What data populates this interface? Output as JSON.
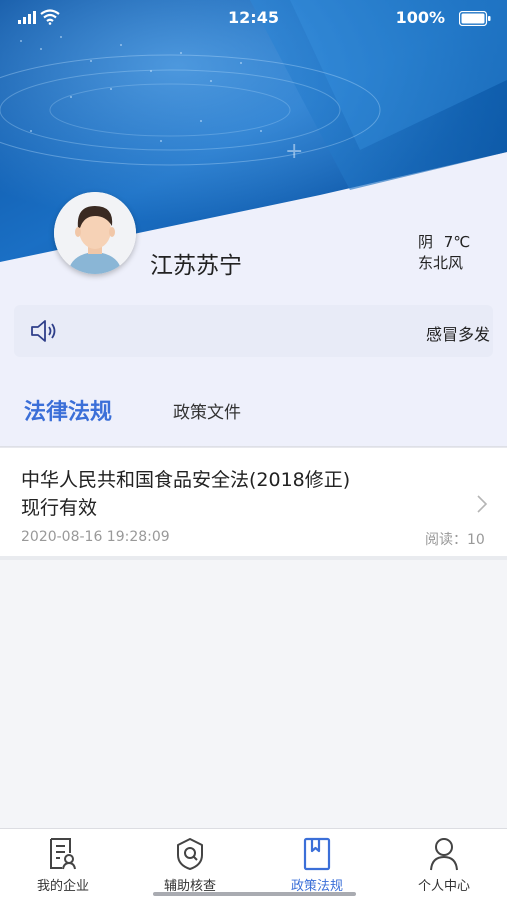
{
  "status_bar": {
    "time": "12:45",
    "battery": "100%",
    "icons": [
      "signal-icon",
      "wifi-icon",
      "battery-icon"
    ]
  },
  "profile": {
    "location": "江苏苏宁",
    "weather_condition": "阴",
    "temperature": "7℃",
    "wind": "东北风"
  },
  "notice": {
    "icon": "speaker-icon",
    "text": "感冒多发"
  },
  "tabs": [
    {
      "label": "法律法规",
      "active": true
    },
    {
      "label": "政策文件",
      "active": false
    }
  ],
  "list": [
    {
      "title": "中华人民共和国食品安全法(2018修正)现行有效",
      "date": "2020-08-16 19:28:09",
      "reads": "阅读：10"
    }
  ],
  "bottom_nav": [
    {
      "label": "我的企业",
      "icon": "enterprise-icon",
      "active": false
    },
    {
      "label": "辅助核查",
      "icon": "shield-check-icon",
      "active": false
    },
    {
      "label": "政策法规",
      "icon": "book-icon",
      "active": true
    },
    {
      "label": "个人中心",
      "icon": "person-icon",
      "active": false
    }
  ],
  "colors": {
    "accent": "#3b6fd8",
    "header_blue": "#1a64b8",
    "background": "#f4f5f8"
  }
}
